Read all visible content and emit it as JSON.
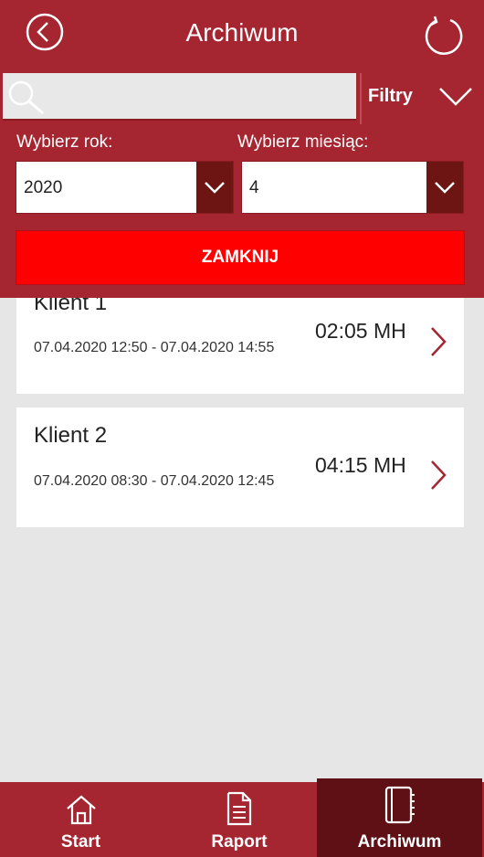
{
  "header": {
    "title": "Archiwum",
    "back_icon": "back-circle-icon",
    "refresh_icon": "refresh-icon"
  },
  "search": {
    "value": "",
    "placeholder": "",
    "icon": "search-icon"
  },
  "filters": {
    "toggle_label": "Filtry",
    "year_label": "Wybierz rok:",
    "year_value": "2020",
    "month_label": "Wybierz miesiąc:",
    "month_value": "4",
    "close_label": "ZAMKNIJ"
  },
  "entries": [
    {
      "client": "Klient 1",
      "range": "07.04.2020 12:50 - 07.04.2020 14:55",
      "duration": "02:05 MH"
    },
    {
      "client": "Klient 2",
      "range": "07.04.2020 08:30 - 07.04.2020 12:45",
      "duration": "04:15 MH"
    }
  ],
  "nav": {
    "items": [
      {
        "label": "Start",
        "icon": "home-icon"
      },
      {
        "label": "Raport",
        "icon": "document-icon"
      },
      {
        "label": "Archiwum",
        "icon": "notebook-icon"
      }
    ],
    "active": "Archiwum"
  },
  "colors": {
    "header": "#a52530",
    "accent": "#ff0000",
    "dropdown_button": "#6d1513",
    "active_nav": "#5e1015",
    "background": "#e6e6e6"
  }
}
